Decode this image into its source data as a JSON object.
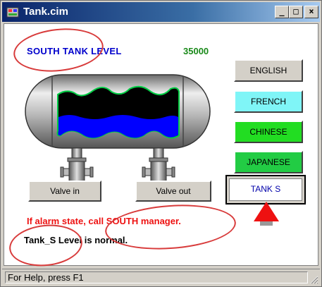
{
  "window": {
    "title": "Tank.cim",
    "minimize_label": "_",
    "maximize_label": "□",
    "close_label": "×"
  },
  "header": {
    "title": "SOUTH TANK LEVEL",
    "value": "35000"
  },
  "language_buttons": [
    {
      "label": "ENGLISH",
      "color": "#d4d0c8"
    },
    {
      "label": "FRENCH",
      "color": "#7ff5f7"
    },
    {
      "label": "CHINESE",
      "color": "#22dd22"
    },
    {
      "label": "JAPANESE",
      "color": "#22cc44"
    }
  ],
  "tank_button": {
    "label": "TANK S"
  },
  "valves": {
    "valve_in_label": "Valve in",
    "valve_out_label": "Valve out"
  },
  "alarm_text": "If alarm state, call SOUTH manager.",
  "level_status": "Tank_S Level is normal.",
  "statusbar": {
    "text": "For Help, press F1"
  },
  "colors": {
    "accent_blue": "#0000cc",
    "value_green": "#1a8a1a",
    "alarm_red": "#ee1111",
    "liquid_blue": "#0000ff",
    "liquid_outline": "#00cc44",
    "annotation_red": "#d83b3b"
  },
  "icons": [
    "app-icon",
    "minimize-icon",
    "maximize-icon",
    "close-icon",
    "pointer-arrow-icon",
    "size-grip-icon"
  ]
}
